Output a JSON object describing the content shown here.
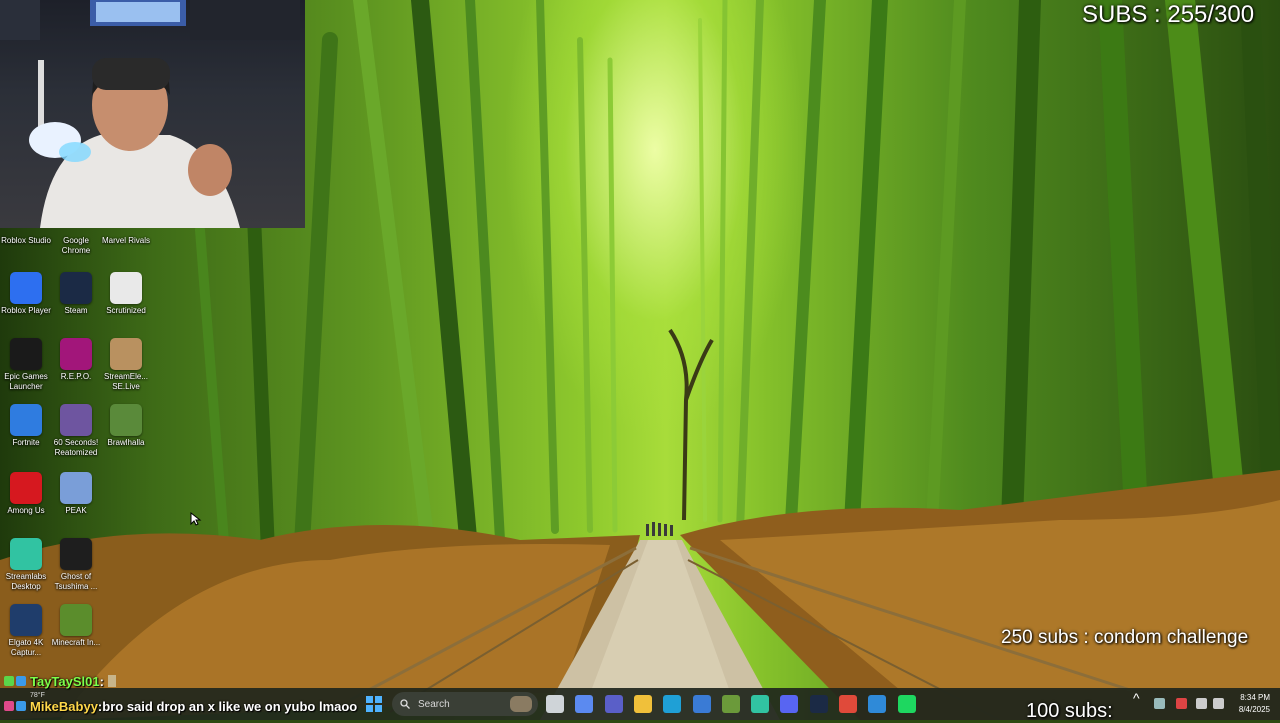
{
  "overlay": {
    "subs_counter": "SUBS : 255/300",
    "goal_text": "250 subs : condom challenge",
    "subs_bottom": "100 subs:"
  },
  "chat": [
    {
      "user": "TayTaySl01",
      "separator": " : ",
      "message": ""
    },
    {
      "user": "MikeBabyy",
      "separator": " : ",
      "message": "bro said drop an x like we on yubo lmaoo"
    }
  ],
  "desktop_icons": [
    {
      "label": "Roblox Studio",
      "icon": "roblox-studio-icon",
      "color": "#2a6bd6"
    },
    {
      "label": "Google Chrome",
      "icon": "chrome-icon",
      "color": "#e8b31c"
    },
    {
      "label": "Marvel Rivals",
      "icon": "marvel-rivals-icon",
      "color": "#c21f2f"
    },
    {
      "label": "Roblox Player",
      "icon": "roblox-player-icon",
      "color": "#2d6ff0"
    },
    {
      "label": "Steam",
      "icon": "steam-icon",
      "color": "#1b2a45"
    },
    {
      "label": "Scrutinized",
      "icon": "document-icon",
      "color": "#e9e9e9"
    },
    {
      "label": "Epic Games Launcher",
      "icon": "epic-games-icon",
      "color": "#1a1a1a"
    },
    {
      "label": "R.E.P.O.",
      "icon": "repo-icon",
      "color": "#a2167a"
    },
    {
      "label": "StreamEle... SE.Live",
      "icon": "streamelements-icon",
      "color": "#b99160"
    },
    {
      "label": "Fortnite",
      "icon": "fortnite-icon",
      "color": "#2f7ce0"
    },
    {
      "label": "60 Seconds! Reatomized",
      "icon": "sixty-seconds-icon",
      "color": "#6e55a0"
    },
    {
      "label": "Brawlhalla",
      "icon": "brawlhalla-icon",
      "color": "#5a8a3a"
    },
    {
      "label": "Among Us",
      "icon": "among-us-icon",
      "color": "#d6181f"
    },
    {
      "label": "PEAK",
      "icon": "peak-icon",
      "color": "#7a9ed8"
    },
    {
      "label": "Streamlabs Desktop",
      "icon": "streamlabs-icon",
      "color": "#31c3a2"
    },
    {
      "label": "Ghost of Tsushima ...",
      "icon": "ghost-of-tsushima-icon",
      "color": "#1e1e1e"
    },
    {
      "label": "Elgato 4K Captur...",
      "icon": "elgato-4k-icon",
      "color": "#1f3d6b"
    },
    {
      "label": "Minecraft In...",
      "icon": "minecraft-icon",
      "color": "#5b8d2c"
    }
  ],
  "taskbar": {
    "search_placeholder": "Search",
    "weather_temp": "78°F",
    "time": "8:34 PM",
    "date": "8/4/2025",
    "pinned_icons": [
      {
        "name": "task-view-icon",
        "color": "#cfd4d8"
      },
      {
        "name": "copilot-icon",
        "color": "#5b8af0"
      },
      {
        "name": "teams-icon",
        "color": "#5a5fc8"
      },
      {
        "name": "file-explorer-icon",
        "color": "#f0c03a"
      },
      {
        "name": "edge-icon",
        "color": "#1fa0d6"
      },
      {
        "name": "store-icon",
        "color": "#3a7bd5"
      },
      {
        "name": "minecraft-taskbar-icon",
        "color": "#6b9a3a"
      },
      {
        "name": "streamlabs-taskbar-icon",
        "color": "#31c3a2"
      },
      {
        "name": "discord-icon",
        "color": "#5865f2"
      },
      {
        "name": "steam-taskbar-icon",
        "color": "#1b2a45"
      },
      {
        "name": "chrome-taskbar-icon",
        "color": "#e04a3a"
      },
      {
        "name": "photos-icon",
        "color": "#2f8ad8"
      },
      {
        "name": "spotify-icon",
        "color": "#1ed760"
      }
    ]
  }
}
